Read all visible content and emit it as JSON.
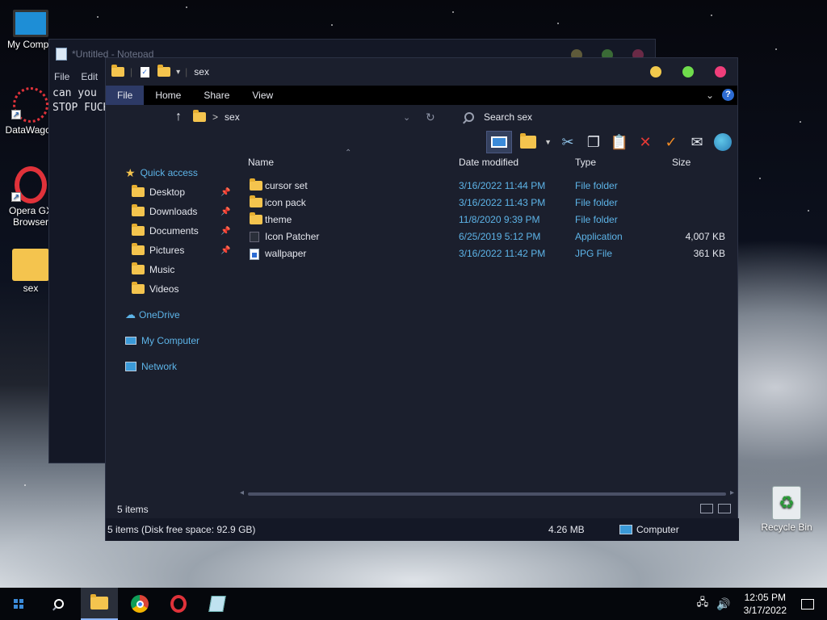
{
  "desktop": {
    "icons": [
      {
        "label": "My Compu",
        "icon": "monitor-icon"
      },
      {
        "label": "DataWagon",
        "icon": "datawagon-icon"
      },
      {
        "label": "Opera GX Browser",
        "line1": "Opera GX",
        "line2": "Browser",
        "icon": "opera-gx-icon"
      },
      {
        "label": "sex",
        "icon": "folder-icon"
      }
    ],
    "recycle_bin": "Recycle Bin"
  },
  "notepad": {
    "title": "*Untitled - Notepad",
    "menu": [
      "File",
      "Edit"
    ],
    "text_line1": "can you",
    "text_line2": "STOP FUCK"
  },
  "explorer": {
    "title": "sex",
    "window_buttons": {
      "minimize": "#f2c94c",
      "maximize": "#6fdc4c",
      "close": "#ef3e7a"
    },
    "ribbon_tabs": [
      "File",
      "Home",
      "Share",
      "View"
    ],
    "active_tab": "File",
    "address": {
      "path": "sex",
      "separator": ">"
    },
    "search": {
      "placeholder": "Search sex"
    },
    "nav": {
      "quick_access": "Quick access",
      "pinned": [
        "Desktop",
        "Downloads",
        "Documents",
        "Pictures"
      ],
      "other": [
        "Music",
        "Videos"
      ],
      "onedrive": "OneDrive",
      "my_computer": "My Computer",
      "network": "Network"
    },
    "columns": {
      "name": "Name",
      "date": "Date modified",
      "type": "Type",
      "size": "Size"
    },
    "files": [
      {
        "name": "cursor set",
        "date": "3/16/2022 11:44 PM",
        "type": "File folder",
        "size": "",
        "icon": "folder-icon"
      },
      {
        "name": "icon pack",
        "date": "3/16/2022 11:43 PM",
        "type": "File folder",
        "size": "",
        "icon": "folder-icon"
      },
      {
        "name": "theme",
        "date": "11/8/2020 9:39 PM",
        "type": "File folder",
        "size": "",
        "icon": "folder-icon"
      },
      {
        "name": "Icon Patcher",
        "date": "6/25/2019 5:12 PM",
        "type": "Application",
        "size": "4,007 KB",
        "icon": "application-icon"
      },
      {
        "name": "wallpaper",
        "date": "3/16/2022 11:42 PM",
        "type": "JPG File",
        "size": "361 KB",
        "icon": "image-file-icon"
      }
    ],
    "item_count": "5 items",
    "status_detail": "5 items (Disk free space: 92.9 GB)",
    "status_size": "4.26 MB",
    "status_location": "Computer"
  },
  "taskbar": {
    "time": "12:05 PM",
    "date": "3/17/2022",
    "apps": [
      "start-icon",
      "search-icon",
      "file-explorer-icon",
      "chrome-icon",
      "opera-gx-icon",
      "notepad-icon"
    ]
  },
  "colors": {
    "accent": "#5db4e8",
    "folder": "#f4c44e",
    "window_bg": "#1b1f2d",
    "ribbon_active": "#2d3a66"
  }
}
